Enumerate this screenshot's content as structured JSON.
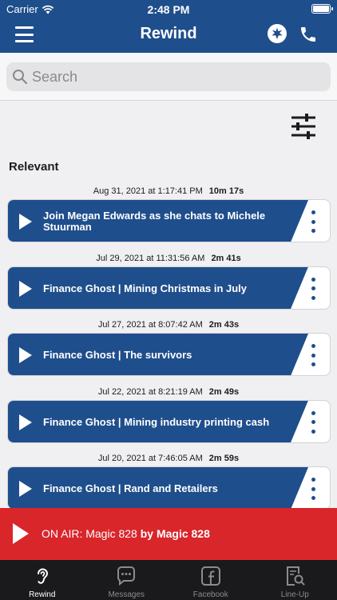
{
  "status_bar": {
    "carrier": "Carrier",
    "time": "2:48 PM"
  },
  "nav": {
    "title": "Rewind",
    "menu_icon": "hamburger-menu-icon",
    "star_icon": "star-badge-icon",
    "phone_icon": "phone-icon"
  },
  "search": {
    "placeholder": "Search"
  },
  "section": {
    "title": "Relevant"
  },
  "items": [
    {
      "date": "Aug 31, 2021 at 1:17:41 PM",
      "duration": "10m 17s",
      "title": "Join Megan Edwards as she chats to Michele Stuurman"
    },
    {
      "date": "Jul 29, 2021 at 11:31:56 AM",
      "duration": "2m 41s",
      "title": "Finance Ghost | Mining Christmas in July"
    },
    {
      "date": "Jul 27, 2021 at 8:07:42 AM",
      "duration": "2m 43s",
      "title": "Finance Ghost | The survivors"
    },
    {
      "date": "Jul 22, 2021 at 8:21:19 AM",
      "duration": "2m 49s",
      "title": "Finance Ghost | Mining industry printing cash"
    },
    {
      "date": "Jul 20, 2021 at 7:46:05 AM",
      "duration": "2m 59s",
      "title": "Finance Ghost | Rand and Retailers"
    }
  ],
  "on_air": {
    "prefix": "ON AIR: Magic 828",
    "by": "by Magic 828"
  },
  "tabs": [
    {
      "label": "Rewind",
      "icon": "ear-icon",
      "active": true
    },
    {
      "label": "Messages",
      "icon": "chat-bubble-icon",
      "active": false
    },
    {
      "label": "Facebook",
      "icon": "facebook-icon",
      "active": false
    },
    {
      "label": "Line-Up",
      "icon": "lineup-search-icon",
      "active": false
    }
  ],
  "colors": {
    "brand_blue": "#1f4e8c",
    "on_air_red": "#d9262b",
    "tabbar": "#1a1a1c"
  }
}
